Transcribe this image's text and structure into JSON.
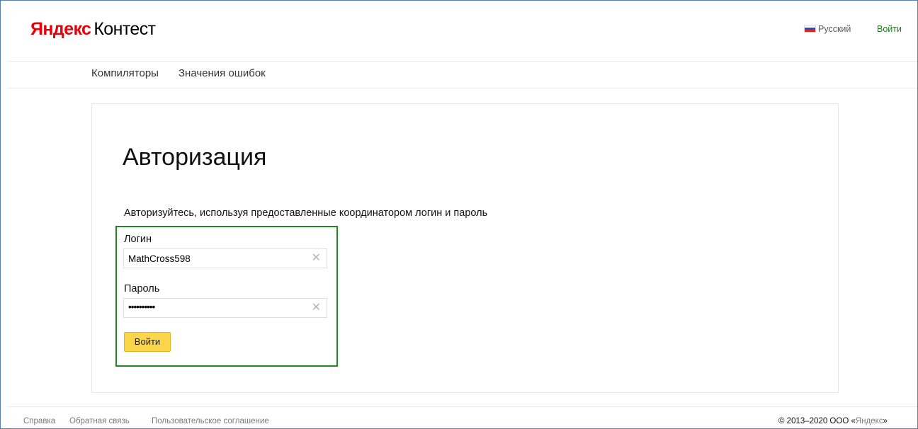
{
  "header": {
    "logo_brand": "Яндекс",
    "logo_product": "Контест",
    "language": "Русский",
    "login_link": "Войти"
  },
  "subnav": {
    "items": [
      "Компиляторы",
      "Значения ошибок"
    ]
  },
  "auth": {
    "title": "Авторизация",
    "description": "Авторизуйтесь, используя предоставленные координатором логин и пароль",
    "login_label": "Логин",
    "login_value": "MathCross598",
    "password_label": "Пароль",
    "password_value": "••••••••••",
    "submit_label": "Войти"
  },
  "footer": {
    "links": [
      "Справка",
      "Обратная связь",
      "Пользовательское соглашение"
    ],
    "copyright_prefix": "© 2013–2020 ООО «",
    "copyright_name": "Яндекс",
    "copyright_suffix": "»"
  },
  "colors": {
    "accent_green": "#1a7a1a",
    "button_yellow": "#fcd64a",
    "brand_red": "#e6000a",
    "highlight_border": "#1f8a1f"
  },
  "icons": {
    "clear": "close-icon",
    "flag": "russia-flag-icon"
  }
}
